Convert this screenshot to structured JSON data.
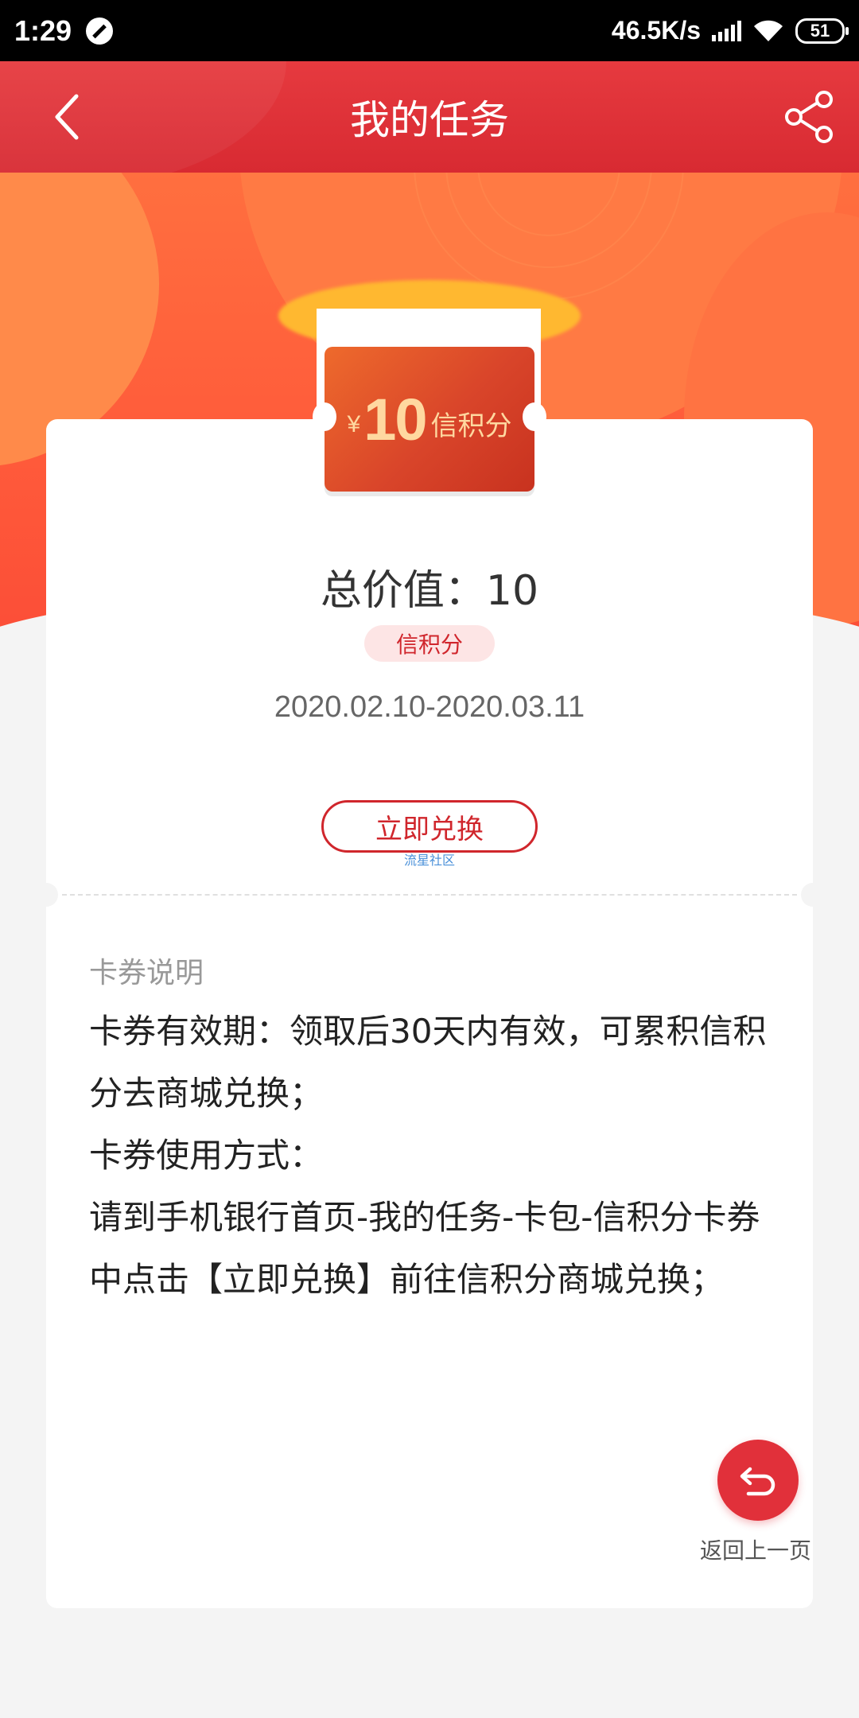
{
  "status_bar": {
    "time": "1:29",
    "network_speed": "46.5K/s",
    "battery": "51"
  },
  "header": {
    "title": "我的任务",
    "back_icon": "chevron-left-icon",
    "share_icon": "share-icon"
  },
  "coupon": {
    "currency": "¥",
    "amount": "10",
    "unit": "信积分"
  },
  "details": {
    "total_value": "总价值：10",
    "tag": "信积分",
    "validity": "2020.02.10-2020.03.11",
    "redeem_button": "立即兑换",
    "watermark": "流星社区"
  },
  "description": {
    "title": "卡券说明",
    "lines": [
      "卡券有效期：领取后30天内有效，可累积信积分去商城兑换；",
      "卡券使用方式：",
      "请到手机银行首页-我的任务-卡包-信积分卡券中点击【立即兑换】前往信积分商城兑换；"
    ]
  },
  "fab": {
    "label": "返回上一页",
    "icon": "return-arrow-icon"
  },
  "colors": {
    "brand_red": "#d0262c",
    "header_red": "#e63a3f",
    "hero_orange": "#ff6f3f"
  }
}
